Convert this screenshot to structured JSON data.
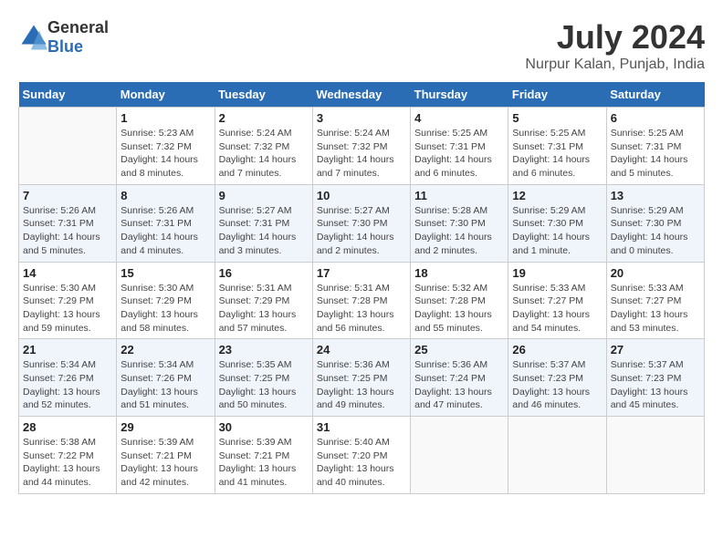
{
  "logo": {
    "general": "General",
    "blue": "Blue"
  },
  "title": "July 2024",
  "subtitle": "Nurpur Kalan, Punjab, India",
  "headers": [
    "Sunday",
    "Monday",
    "Tuesday",
    "Wednesday",
    "Thursday",
    "Friday",
    "Saturday"
  ],
  "weeks": [
    [
      {
        "day": "",
        "info": ""
      },
      {
        "day": "1",
        "info": "Sunrise: 5:23 AM\nSunset: 7:32 PM\nDaylight: 14 hours\nand 8 minutes."
      },
      {
        "day": "2",
        "info": "Sunrise: 5:24 AM\nSunset: 7:32 PM\nDaylight: 14 hours\nand 7 minutes."
      },
      {
        "day": "3",
        "info": "Sunrise: 5:24 AM\nSunset: 7:32 PM\nDaylight: 14 hours\nand 7 minutes."
      },
      {
        "day": "4",
        "info": "Sunrise: 5:25 AM\nSunset: 7:31 PM\nDaylight: 14 hours\nand 6 minutes."
      },
      {
        "day": "5",
        "info": "Sunrise: 5:25 AM\nSunset: 7:31 PM\nDaylight: 14 hours\nand 6 minutes."
      },
      {
        "day": "6",
        "info": "Sunrise: 5:25 AM\nSunset: 7:31 PM\nDaylight: 14 hours\nand 5 minutes."
      }
    ],
    [
      {
        "day": "7",
        "info": "Sunrise: 5:26 AM\nSunset: 7:31 PM\nDaylight: 14 hours\nand 5 minutes."
      },
      {
        "day": "8",
        "info": "Sunrise: 5:26 AM\nSunset: 7:31 PM\nDaylight: 14 hours\nand 4 minutes."
      },
      {
        "day": "9",
        "info": "Sunrise: 5:27 AM\nSunset: 7:31 PM\nDaylight: 14 hours\nand 3 minutes."
      },
      {
        "day": "10",
        "info": "Sunrise: 5:27 AM\nSunset: 7:30 PM\nDaylight: 14 hours\nand 2 minutes."
      },
      {
        "day": "11",
        "info": "Sunrise: 5:28 AM\nSunset: 7:30 PM\nDaylight: 14 hours\nand 2 minutes."
      },
      {
        "day": "12",
        "info": "Sunrise: 5:29 AM\nSunset: 7:30 PM\nDaylight: 14 hours\nand 1 minute."
      },
      {
        "day": "13",
        "info": "Sunrise: 5:29 AM\nSunset: 7:30 PM\nDaylight: 14 hours\nand 0 minutes."
      }
    ],
    [
      {
        "day": "14",
        "info": "Sunrise: 5:30 AM\nSunset: 7:29 PM\nDaylight: 13 hours\nand 59 minutes."
      },
      {
        "day": "15",
        "info": "Sunrise: 5:30 AM\nSunset: 7:29 PM\nDaylight: 13 hours\nand 58 minutes."
      },
      {
        "day": "16",
        "info": "Sunrise: 5:31 AM\nSunset: 7:29 PM\nDaylight: 13 hours\nand 57 minutes."
      },
      {
        "day": "17",
        "info": "Sunrise: 5:31 AM\nSunset: 7:28 PM\nDaylight: 13 hours\nand 56 minutes."
      },
      {
        "day": "18",
        "info": "Sunrise: 5:32 AM\nSunset: 7:28 PM\nDaylight: 13 hours\nand 55 minutes."
      },
      {
        "day": "19",
        "info": "Sunrise: 5:33 AM\nSunset: 7:27 PM\nDaylight: 13 hours\nand 54 minutes."
      },
      {
        "day": "20",
        "info": "Sunrise: 5:33 AM\nSunset: 7:27 PM\nDaylight: 13 hours\nand 53 minutes."
      }
    ],
    [
      {
        "day": "21",
        "info": "Sunrise: 5:34 AM\nSunset: 7:26 PM\nDaylight: 13 hours\nand 52 minutes."
      },
      {
        "day": "22",
        "info": "Sunrise: 5:34 AM\nSunset: 7:26 PM\nDaylight: 13 hours\nand 51 minutes."
      },
      {
        "day": "23",
        "info": "Sunrise: 5:35 AM\nSunset: 7:25 PM\nDaylight: 13 hours\nand 50 minutes."
      },
      {
        "day": "24",
        "info": "Sunrise: 5:36 AM\nSunset: 7:25 PM\nDaylight: 13 hours\nand 49 minutes."
      },
      {
        "day": "25",
        "info": "Sunrise: 5:36 AM\nSunset: 7:24 PM\nDaylight: 13 hours\nand 47 minutes."
      },
      {
        "day": "26",
        "info": "Sunrise: 5:37 AM\nSunset: 7:23 PM\nDaylight: 13 hours\nand 46 minutes."
      },
      {
        "day": "27",
        "info": "Sunrise: 5:37 AM\nSunset: 7:23 PM\nDaylight: 13 hours\nand 45 minutes."
      }
    ],
    [
      {
        "day": "28",
        "info": "Sunrise: 5:38 AM\nSunset: 7:22 PM\nDaylight: 13 hours\nand 44 minutes."
      },
      {
        "day": "29",
        "info": "Sunrise: 5:39 AM\nSunset: 7:21 PM\nDaylight: 13 hours\nand 42 minutes."
      },
      {
        "day": "30",
        "info": "Sunrise: 5:39 AM\nSunset: 7:21 PM\nDaylight: 13 hours\nand 41 minutes."
      },
      {
        "day": "31",
        "info": "Sunrise: 5:40 AM\nSunset: 7:20 PM\nDaylight: 13 hours\nand 40 minutes."
      },
      {
        "day": "",
        "info": ""
      },
      {
        "day": "",
        "info": ""
      },
      {
        "day": "",
        "info": ""
      }
    ]
  ]
}
